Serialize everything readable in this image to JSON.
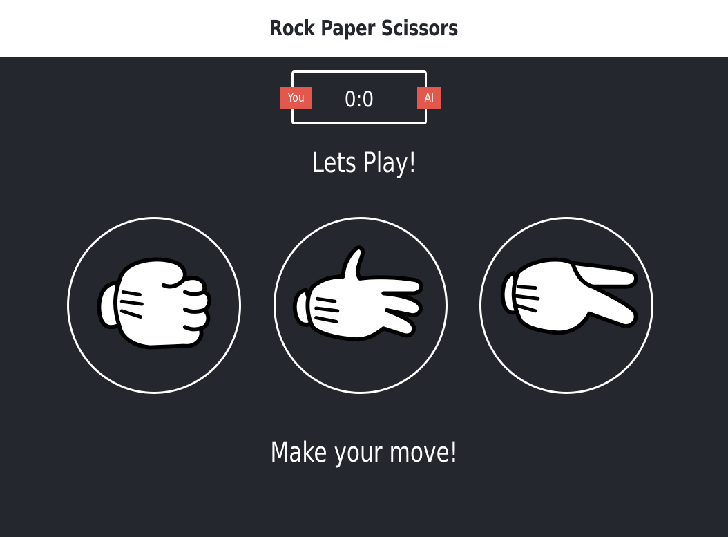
{
  "header": {
    "title": "Rock Paper Scissors"
  },
  "scoreboard": {
    "user_label": "You",
    "computer_label": "AI",
    "score": "0:0"
  },
  "result_text": "Lets Play!",
  "choices": [
    {
      "id": "rock",
      "icon": "rock-hand-icon"
    },
    {
      "id": "paper",
      "icon": "paper-hand-icon"
    },
    {
      "id": "scissors",
      "icon": "scissors-hand-icon"
    }
  ],
  "action_message": "Make your move!",
  "colors": {
    "background": "#24272e",
    "header": "#ffffff",
    "badge": "#e2584d",
    "text": "#ffffff"
  }
}
